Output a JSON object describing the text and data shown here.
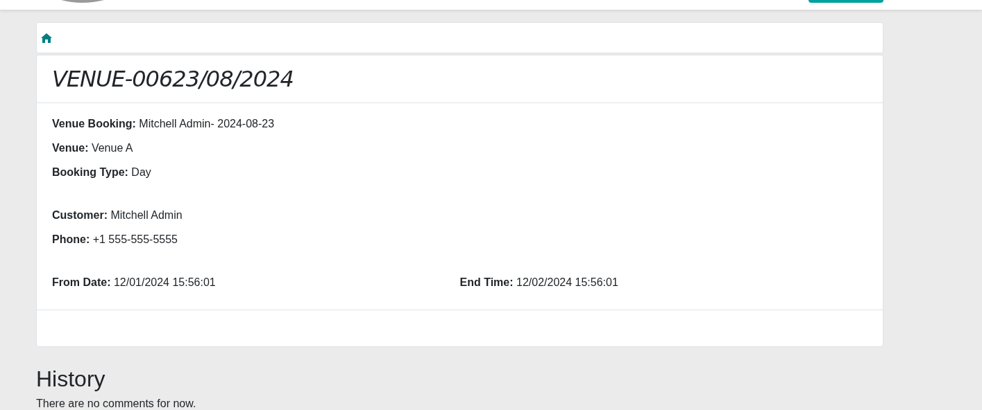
{
  "title": "VENUE-00623/08/2024",
  "field_groups": [
    [
      {
        "label": "Venue Booking:",
        "value": "Mitchell Admin- 2024-08-23"
      },
      {
        "label": "Venue:",
        "value": "Venue A"
      },
      {
        "label": "Booking Type:",
        "value": "Day"
      }
    ],
    [
      {
        "label": "Customer:",
        "value": "Mitchell Admin"
      },
      {
        "label": "Phone:",
        "value": "+1 555-555-5555"
      }
    ]
  ],
  "date_row": [
    {
      "label": "From Date:",
      "value": "12/01/2024 15:56:01"
    },
    {
      "label": "End Time:",
      "value": "12/02/2024 15:56:01"
    }
  ],
  "history": {
    "heading": "History",
    "message": "There are no comments for now."
  }
}
